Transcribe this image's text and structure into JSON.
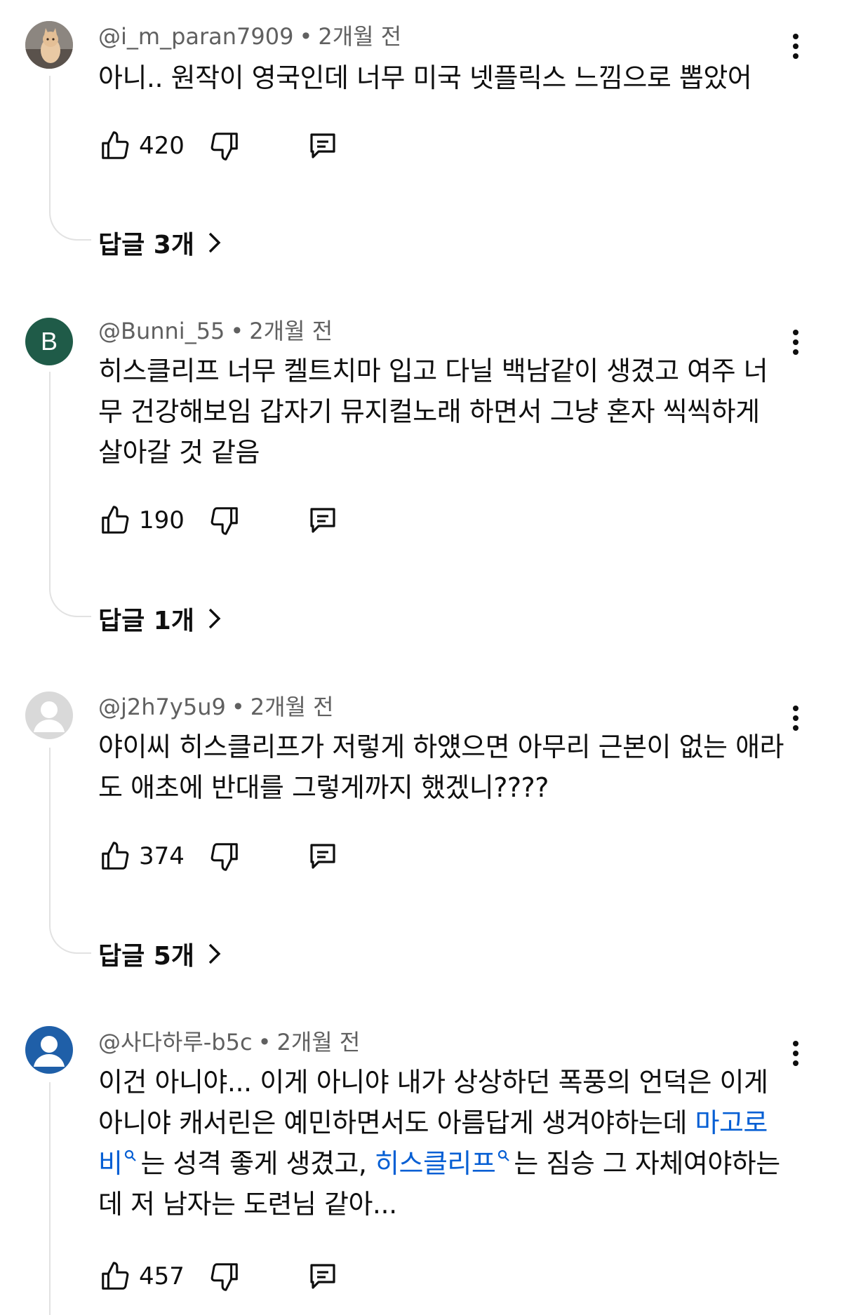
{
  "comments": [
    {
      "username": "@i_m_paran7909",
      "time": "2개월 전",
      "text": "아니.. 원작이 영국인데 너무 미국 넷플릭스 느낌으로 뽑았어",
      "likes": "420",
      "replies": "답글 3개",
      "avatar": "cat-photo"
    },
    {
      "username": "@Bunni_55",
      "time": "2개월 전",
      "text": "히스클리프 너무 켈트치마 입고 다닐 백남같이 생겼고 여주 너무 건강해보임 갑자기 뮤지컬노래 하면서 그냥 혼자 씩씩하게 살아갈 것 같음",
      "likes": "190",
      "replies": "답글 1개",
      "avatar": "B",
      "avatar_color": "#1f5b48"
    },
    {
      "username": "@j2h7y5u9",
      "time": "2개월 전",
      "text": "야이씨 히스클리프가 저렇게 하얬으면 아무리 근본이 없는 애라도 애초에 반대를 그렇게까지 했겠니????",
      "likes": "374",
      "replies": "답글 5개",
      "avatar": "default-gray"
    },
    {
      "username": "@사다하루-b5c",
      "time": "2개월 전",
      "text_part1": "이건 아니야... 이게 아니야 내가 상상하던 폭풍의 언덕은 이게 아니야 캐서린은 예민하면서도 아름답게 생겨야하는데 ",
      "link1": "마고로비",
      "text_part2": "는 성격 좋게 생겼고, ",
      "link2": "히스클리프",
      "text_part3": "는 짐승 그 자체여야하는데 저 남자는 도련님 같아...",
      "likes": "457",
      "avatar": "default-blue"
    }
  ],
  "dot": "•"
}
